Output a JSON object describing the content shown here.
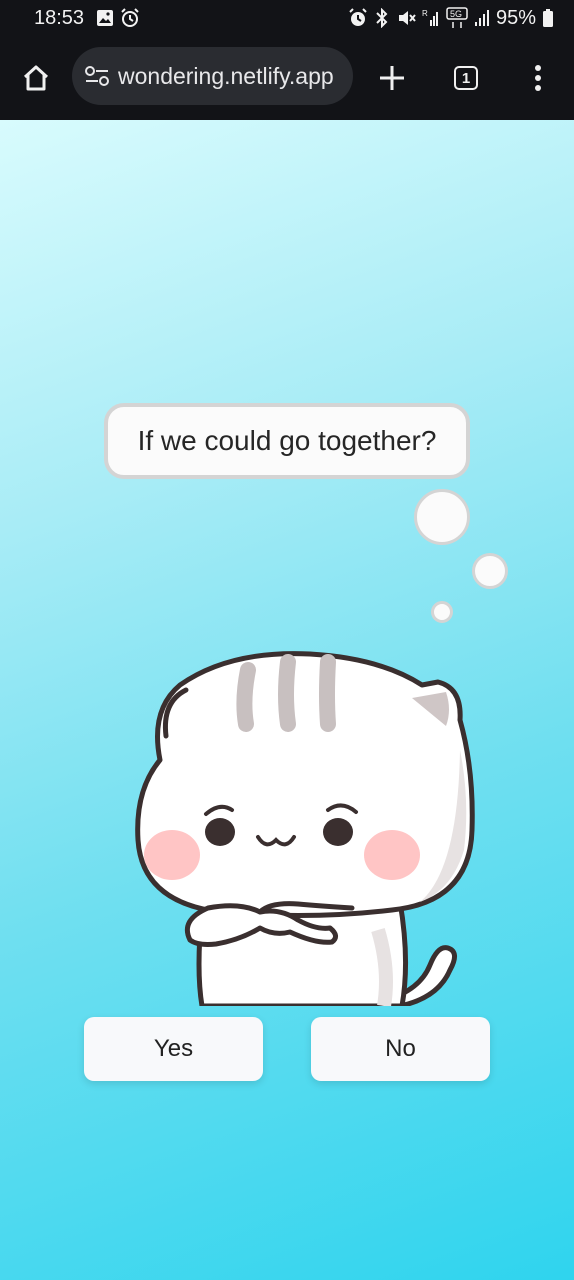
{
  "status_bar": {
    "time": "18:53",
    "battery": "95%",
    "left_icons": [
      "image-icon",
      "alarm-icon"
    ],
    "right_icons": [
      "alarm-icon",
      "bluetooth-icon",
      "mute-icon",
      "signal-icon",
      "5g-icon",
      "signal-icon",
      "battery-icon"
    ]
  },
  "browser": {
    "url": "wondering.netlify.app",
    "tab_count": "1"
  },
  "page": {
    "question": "If we could go together?",
    "yes_label": "Yes",
    "no_label": "No"
  },
  "colors": {
    "background_start": "#d8fbfd",
    "background_end": "#2fd4ee",
    "button_bg": "#f8f9fb"
  }
}
